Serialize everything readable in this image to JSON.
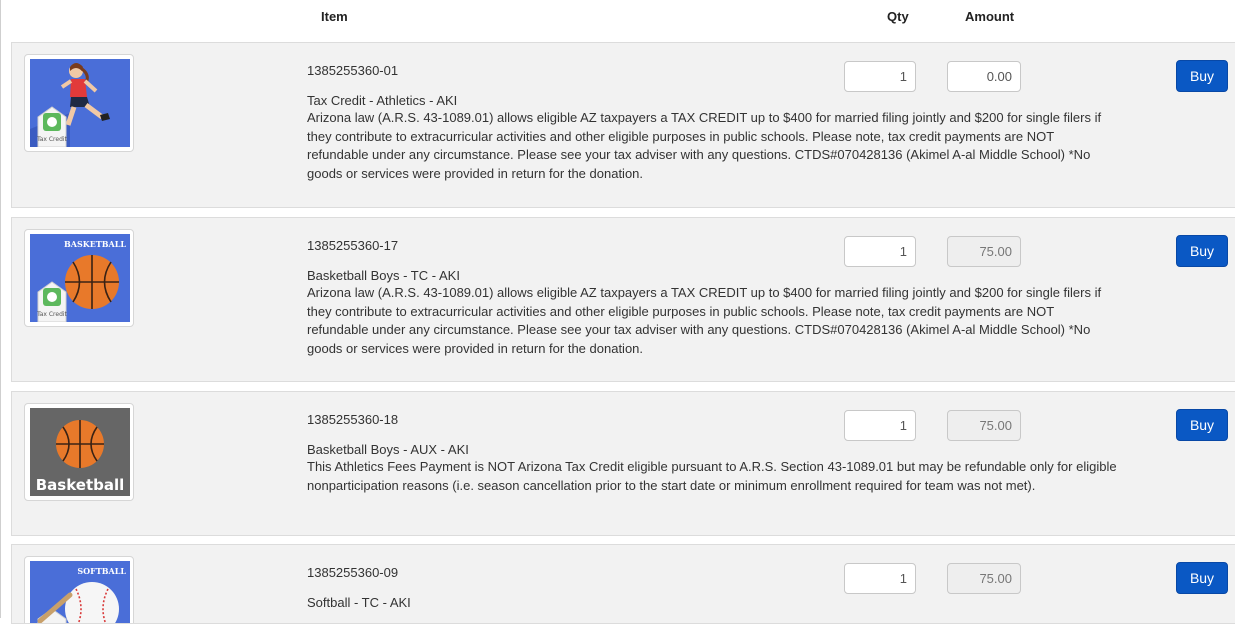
{
  "header": {
    "item": "Item",
    "qty": "Qty",
    "amount": "Amount"
  },
  "rows": [
    {
      "sku": "1385255360-01",
      "title": "Tax Credit - Athletics - AKI",
      "description": "Arizona law (A.R.S. 43-1089.01) allows eligible AZ taxpayers a TAX CREDIT up to $400 for married filing jointly and $200 for single filers if they contribute to extracurricular activities and other eligible purposes in public schools. Please note, tax credit payments are NOT refundable under any circumstance. Please see your tax adviser with any questions. CTDS#070428136 (Akimel A-al Middle School) *No goods or services were provided in return for the donation.",
      "qty": "1",
      "amount": "0.00",
      "amount_editable": true,
      "buy_label": "Buy",
      "image": {
        "icon": "runner-tax-credit-icon",
        "caption": "Tax Credit",
        "background": "#4a6ed8"
      }
    },
    {
      "sku": "1385255360-17",
      "title": "Basketball Boys - TC - AKI",
      "description": "Arizona law (A.R.S. 43-1089.01) allows eligible AZ taxpayers a TAX CREDIT up to $400 for married filing jointly and $200 for single filers if they contribute to extracurricular activities and other eligible purposes in public schools. Please note, tax credit payments are NOT refundable under any circumstance. Please see your tax adviser with any questions. CTDS#070428136 (Akimel A-al Middle School) *No goods or services were provided in return for the donation.",
      "qty": "1",
      "amount": "75.00",
      "amount_editable": false,
      "buy_label": "Buy",
      "image": {
        "icon": "basketball-tax-credit-icon",
        "banner": "BASKETBALL",
        "caption": "Tax Credit",
        "background": "#4a6ed8"
      }
    },
    {
      "sku": "1385255360-18",
      "title": "Basketball Boys - AUX - AKI",
      "description": "This Athletics Fees Payment is NOT Arizona Tax Credit eligible pursuant to A.R.S. Section 43-1089.01 but may be refundable only for eligible nonparticipation reasons (i.e. season cancellation prior to the start date or minimum enrollment required for team was not met).",
      "qty": "1",
      "amount": "75.00",
      "amount_editable": false,
      "buy_label": "Buy",
      "image": {
        "icon": "basketball-icon",
        "caption": "Basketball",
        "background": "#666666"
      }
    },
    {
      "sku": "1385255360-09",
      "title": "Softball - TC - AKI",
      "description": "",
      "qty": "1",
      "amount": "75.00",
      "amount_editable": false,
      "buy_label": "Buy",
      "image": {
        "icon": "softball-tax-credit-icon",
        "banner": "SOFTBALL",
        "background": "#4a6ed8"
      }
    }
  ]
}
